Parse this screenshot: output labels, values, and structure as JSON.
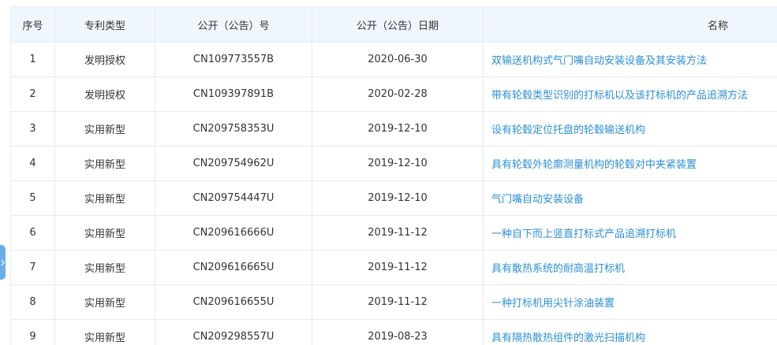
{
  "table": {
    "headers": [
      "序号",
      "专利类型",
      "公开（公告）号",
      "公开（公告）日期",
      "名称"
    ],
    "rows": [
      {
        "index": "1",
        "type": "发明授权",
        "number": "CN109773557B",
        "date": "2020-06-30",
        "name": "双输送机构式气门嘴自动安装设备及其安装方法"
      },
      {
        "index": "2",
        "type": "发明授权",
        "number": "CN109397891B",
        "date": "2020-02-28",
        "name": "带有轮毂类型识别的打标机以及该打标机的产品追溯方法"
      },
      {
        "index": "3",
        "type": "实用新型",
        "number": "CN209758353U",
        "date": "2019-12-10",
        "name": "设有轮毂定位托盘的轮毂输送机构"
      },
      {
        "index": "4",
        "type": "实用新型",
        "number": "CN209754962U",
        "date": "2019-12-10",
        "name": "具有轮毂外轮廓测量机构的轮毂对中夹紧装置"
      },
      {
        "index": "5",
        "type": "实用新型",
        "number": "CN209754447U",
        "date": "2019-12-10",
        "name": "气门嘴自动安装设备"
      },
      {
        "index": "6",
        "type": "实用新型",
        "number": "CN209616666U",
        "date": "2019-11-12",
        "name": "一种自下而上竖直打标式产品追溯打标机"
      },
      {
        "index": "7",
        "type": "实用新型",
        "number": "CN209616665U",
        "date": "2019-11-12",
        "name": "具有散热系统的耐高温打标机"
      },
      {
        "index": "8",
        "type": "实用新型",
        "number": "CN209616655U",
        "date": "2019-11-12",
        "name": "一种打标机用尖针涂油装置"
      },
      {
        "index": "9",
        "type": "实用新型",
        "number": "CN209298557U",
        "date": "2019-08-23",
        "name": "具有隔热散热组件的激光扫描机构"
      }
    ]
  },
  "side_tab": {
    "icon": "chevron-right-icon"
  },
  "colors": {
    "link": "#2b8fd6",
    "header_bg": "#f0f6fd",
    "border": "#e6eaf0",
    "side_tab": "#6aaee8"
  }
}
